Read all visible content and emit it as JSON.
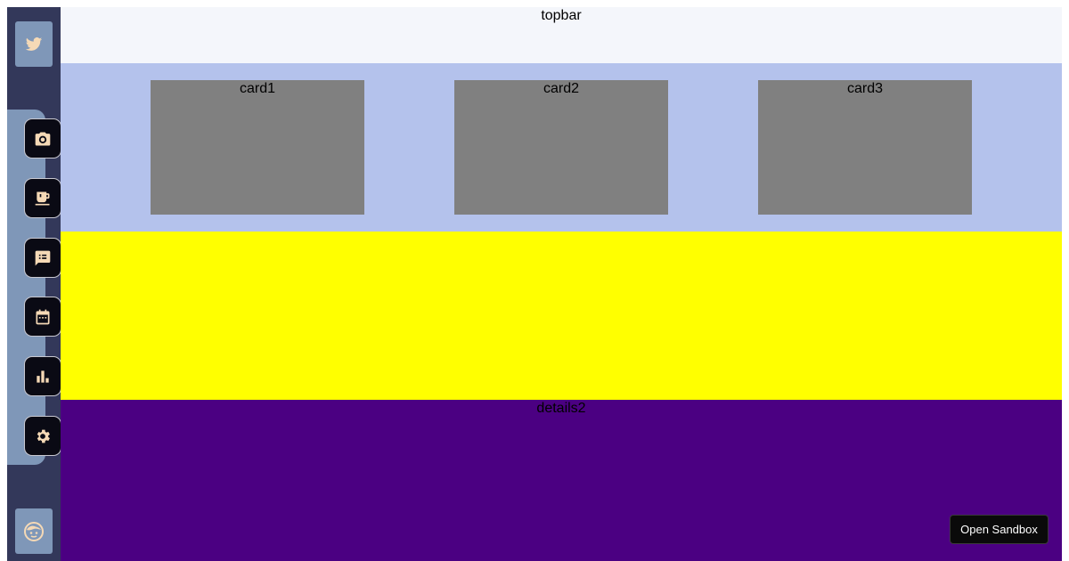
{
  "colors": {
    "sidebar_bg": "#33385a",
    "sidebar_panel": "#7f97b8",
    "nav_button_bg": "#0a0a14",
    "icon_color": "#f5d9b6",
    "topbar_bg": "#f4f6fb",
    "cards_section_bg": "#b4c2ec",
    "card_bg": "#808080",
    "details1_bg": "#ffff00",
    "details2_bg": "#4b0082"
  },
  "sidebar": {
    "top_icon": "twitter-bird-icon",
    "nav_items": [
      {
        "icon": "camera-icon"
      },
      {
        "icon": "coffee-cup-icon"
      },
      {
        "icon": "chat-list-icon"
      },
      {
        "icon": "calendar-icon"
      },
      {
        "icon": "bar-chart-icon"
      },
      {
        "icon": "gear-icon"
      }
    ],
    "bottom_icon": "user-face-icon"
  },
  "topbar": {
    "label": "topbar"
  },
  "cards": [
    {
      "label": "card1"
    },
    {
      "label": "card2"
    },
    {
      "label": "card3"
    }
  ],
  "details2": {
    "label": "details2"
  },
  "sandbox_button": {
    "label": "Open Sandbox"
  }
}
